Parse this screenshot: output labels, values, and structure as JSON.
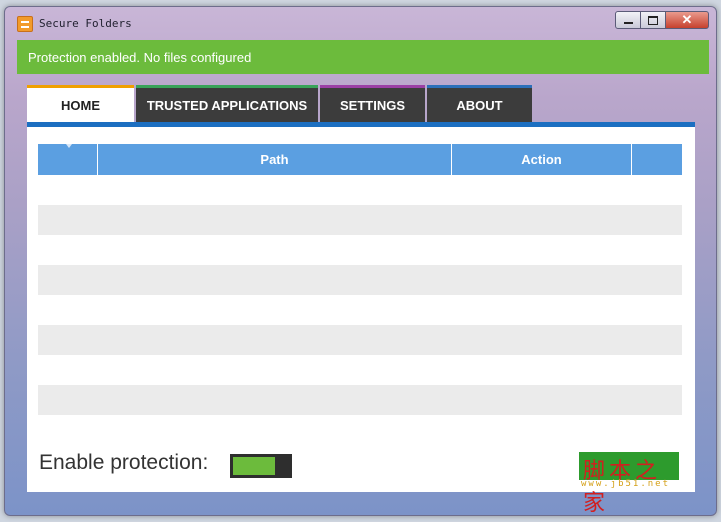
{
  "window": {
    "title": "Secure Folders",
    "controls": {
      "minimize": "",
      "maximize": "",
      "close": "✕"
    }
  },
  "status": {
    "text": "Protection enabled. No files configured",
    "color": "#6cbb3c"
  },
  "tabs": [
    {
      "label": "HOME",
      "active": true,
      "accent": "#f0a000"
    },
    {
      "label": "TRUSTED APPLICATIONS",
      "active": false,
      "accent": "#3aa35a"
    },
    {
      "label": "SETTINGS",
      "active": false,
      "accent": "#9b3fa5"
    },
    {
      "label": "ABOUT",
      "active": false,
      "accent": "#2d6fb8"
    }
  ],
  "table": {
    "columns": [
      "",
      "Path",
      "Action",
      ""
    ],
    "rows": []
  },
  "protection": {
    "label": "Enable protection:",
    "enabled": true
  },
  "watermark": {
    "cn": "脚本之家",
    "url": "www.jb51.net"
  },
  "colors": {
    "accent_blue": "#1c6fc1",
    "header_blue": "#5b9fe1"
  }
}
